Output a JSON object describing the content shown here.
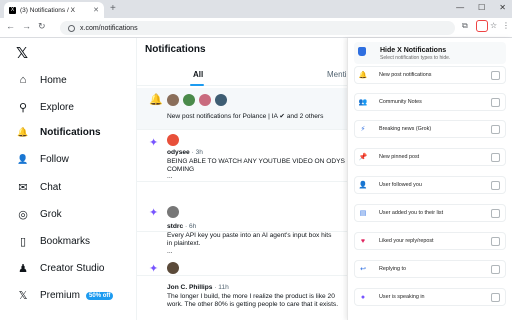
{
  "browser": {
    "tab_title": "(3) Notifications / X",
    "url": "x.com/notifications",
    "new_tab_label": "+"
  },
  "sidebar": {
    "logo": "𝕏",
    "items": [
      {
        "label": "Home",
        "icon": "home-icon",
        "glyph": "⌂"
      },
      {
        "label": "Explore",
        "icon": "search-icon",
        "glyph": "⚲"
      },
      {
        "label": "Notifications",
        "icon": "bell-icon",
        "glyph": "🔔"
      },
      {
        "label": "Follow",
        "icon": "add-person-icon",
        "glyph": "👤"
      },
      {
        "label": "Chat",
        "icon": "mail-icon",
        "glyph": "✉"
      },
      {
        "label": "Grok",
        "icon": "grok-icon",
        "glyph": "◎"
      },
      {
        "label": "Bookmarks",
        "icon": "bookmark-icon",
        "glyph": "▯"
      },
      {
        "label": "Creator Studio",
        "icon": "creator-icon",
        "glyph": "♟"
      },
      {
        "label": "Premium",
        "icon": "x-icon",
        "glyph": "𝕏"
      }
    ],
    "premium_badge": "50% off"
  },
  "main": {
    "title": "Notifications",
    "tabs": [
      "All",
      "Mentio"
    ],
    "rows": [
      {
        "line1": "New post notifications for Polance | IA ✔ and 2 others"
      },
      {
        "user": "odysee",
        "time": "· 3h",
        "line1": "BEING ABLE TO WATCH ANY YOUTUBE VIDEO ON ODYS",
        "line2": "COMING",
        "line3": "..."
      },
      {
        "user": "stdrc",
        "time": "· 6h",
        "line1": "Every API key you paste into an AI agent's input box hits",
        "line2": "in plaintext.",
        "line3": "..."
      },
      {
        "user": "Jon C. Phillips",
        "time": "· 11h",
        "line1": "The longer I build, the more I realize the product is like 20",
        "line2": "work. The other 80% is getting people to care that it exists."
      }
    ]
  },
  "popup": {
    "title": "Hide X Notifications",
    "subtitle": "Select notification types to hide.",
    "items": [
      {
        "label": "New post notifications",
        "icon": "bell-icon",
        "glyph": "🔔"
      },
      {
        "label": "Community Notes",
        "icon": "users-icon",
        "glyph": "👥"
      },
      {
        "label": "Breaking news (Grok)",
        "icon": "lightning-icon",
        "glyph": "⚡"
      },
      {
        "label": "New pinned post",
        "icon": "pin-icon",
        "glyph": "📌"
      },
      {
        "label": "User followed you",
        "icon": "user-icon",
        "glyph": "👤"
      },
      {
        "label": "User added you to their list",
        "icon": "list-icon",
        "glyph": "▤"
      },
      {
        "label": "Liked your reply/repost",
        "icon": "heart-icon",
        "glyph": "♥"
      },
      {
        "label": "Replying to",
        "icon": "reply-icon",
        "glyph": "↩"
      },
      {
        "label": "User is speaking in",
        "icon": "mic-icon",
        "glyph": "●"
      }
    ]
  }
}
